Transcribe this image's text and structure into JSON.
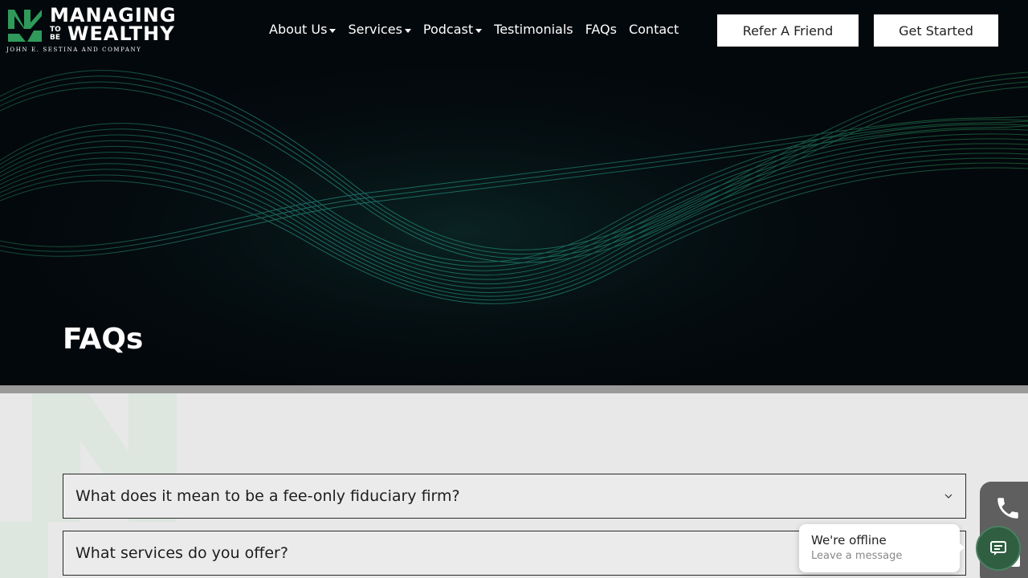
{
  "logo": {
    "line1": "MANAGING",
    "small1": "TO",
    "small2": "BE",
    "line2": "WEALTHY",
    "tagline": "JOHN E. SESTINA AND COMPANY"
  },
  "nav": {
    "items": [
      {
        "label": "About Us",
        "dropdown": true
      },
      {
        "label": "Services",
        "dropdown": true
      },
      {
        "label": "Podcast",
        "dropdown": true
      },
      {
        "label": "Testimonials",
        "dropdown": false
      },
      {
        "label": "FAQs",
        "dropdown": false
      },
      {
        "label": "Contact",
        "dropdown": false
      }
    ],
    "refer_label": "Refer A Friend",
    "start_label": "Get Started"
  },
  "hero": {
    "title": "FAQs"
  },
  "faqs": [
    {
      "question": "What does it mean to be a fee-only fiduciary firm?"
    },
    {
      "question": "What services do you offer?"
    }
  ],
  "chat": {
    "title": "We're offline",
    "subtitle": "Leave a message"
  },
  "colors": {
    "brand_green": "#2f9a5a",
    "teal_wave": "#2fb4a8",
    "hero_bg": "#03080c",
    "chat_button": "#2f5e40"
  },
  "icons": [
    "logo-mark-icon",
    "caret-down-icon",
    "chevron-down-icon",
    "phone-icon",
    "chat-icon"
  ]
}
